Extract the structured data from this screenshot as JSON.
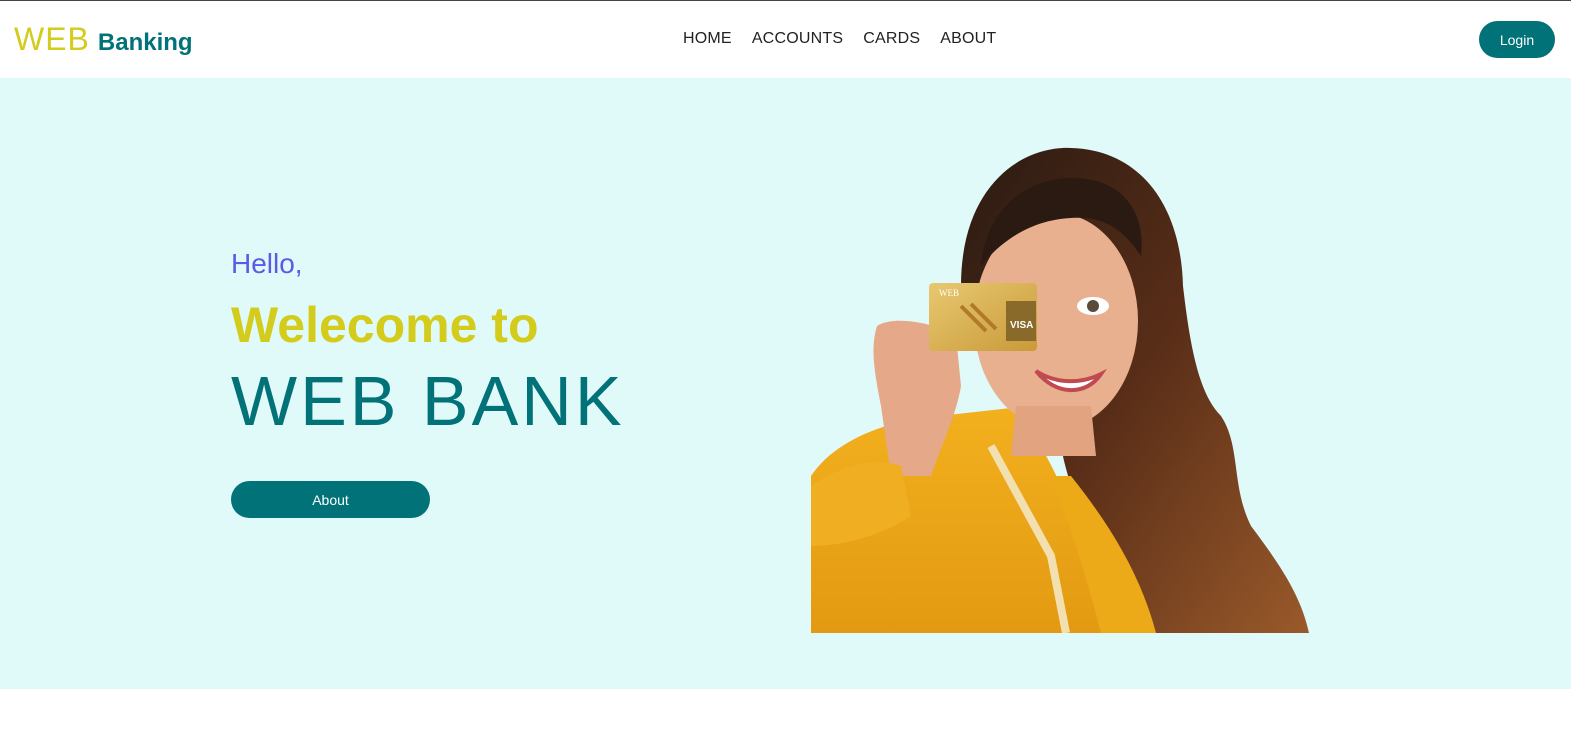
{
  "navbar": {
    "brand": {
      "web": "WEB",
      "banking": "Banking"
    },
    "menu": [
      {
        "label": "HOME"
      },
      {
        "label": "ACCOUNTS"
      },
      {
        "label": "CARDS"
      },
      {
        "label": "ABOUT"
      }
    ],
    "login_label": "Login"
  },
  "hero": {
    "greeting": "Hello,",
    "welcome": "Welecome to",
    "bank_name": "WEB BANK",
    "about_label": "About",
    "card": {
      "brand": "WEB",
      "network": "VISA"
    }
  },
  "colors": {
    "teal": "#007278",
    "yellow": "#d4cc1c",
    "purple": "#5b5be6",
    "hero_bg": "#e0f9f9"
  }
}
